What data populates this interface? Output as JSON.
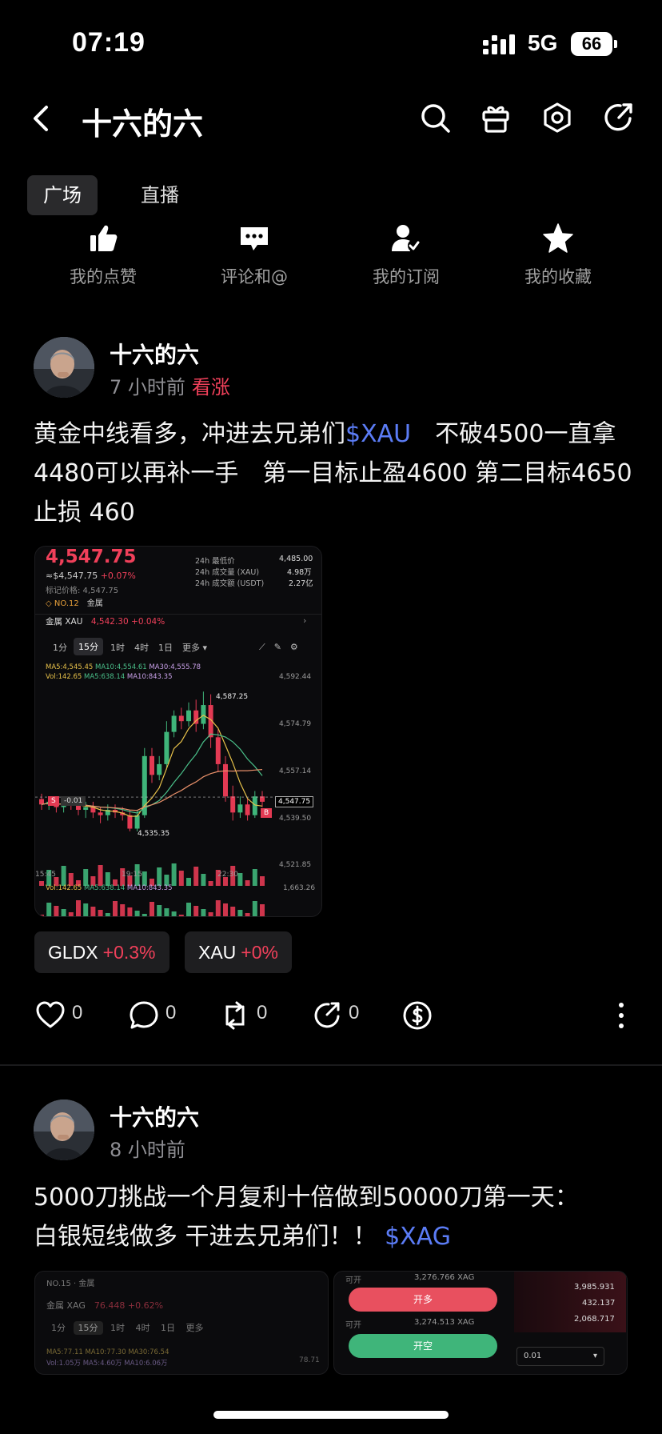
{
  "status_bar": {
    "time": "07:19",
    "network": "5G",
    "battery": "66"
  },
  "header": {
    "title": "十六的六"
  },
  "tabs": [
    {
      "label": "广场"
    },
    {
      "label": "直播"
    }
  ],
  "quick_links": [
    {
      "label": "我的点赞",
      "icon": "thumbs-up-icon"
    },
    {
      "label": "评论和@",
      "icon": "comment-icon"
    },
    {
      "label": "我的订阅",
      "icon": "subscribe-icon"
    },
    {
      "label": "我的收藏",
      "icon": "star-icon"
    }
  ],
  "posts": [
    {
      "author": "十六的六",
      "time": "7 小时前",
      "sentiment": "看涨",
      "text_before": "黄金中线看多，冲进去兄弟们",
      "cashtag": "$XAU",
      "text_after": "　不破4500一直拿 4480可以再补一手　第一目标止盈4600 第二目标4650　止损 460",
      "chart": {
        "price": "4,547.75",
        "sub_price": "≈$4,547.75",
        "sub_change": "+0.07%",
        "mark_price": "标记价格: 4,547.75",
        "rank": "NO.12",
        "rank_tag": "金属",
        "stats": [
          {
            "label": "24h 最低价",
            "value": "4,485.00"
          },
          {
            "label": "24h 成交量 (XAU)",
            "value": "4.98万"
          },
          {
            "label": "24h 成交额 (USDT)",
            "value": "2.27亿"
          }
        ],
        "pair_label": "金属  XAU",
        "pair_price": "4,542.30",
        "pair_change": "+0.04%",
        "intervals": [
          "1分",
          "15分",
          "1时",
          "4时",
          "1日",
          "更多"
        ],
        "active_interval": "15分",
        "ma_line": "MA5:4,545.45",
        "ma10": "MA10:4,554.61",
        "ma30": "MA30:4,555.78",
        "vol_line": "Vol:142.65",
        "vol_ma5": "MA5:638.14",
        "vol_ma10": "MA10:843.35",
        "y_ticks": [
          "4,592.44",
          "4,574.79",
          "4,557.14",
          "4,539.50",
          "4,521.85"
        ],
        "x_ticks": [
          "15:45",
          "19:15",
          "22:30"
        ],
        "high_label": "4,587.25",
        "low_label": "4,535.35",
        "last_label": "4,547.75",
        "vol_max": "1,663.26",
        "marker_s": "S",
        "marker_b": "B",
        "marker_val": "-0.01"
      },
      "chips": [
        {
          "symbol": "GLDX",
          "change": "+0.3%"
        },
        {
          "symbol": "XAU",
          "change": "+0%"
        }
      ],
      "actions": {
        "likes": "0",
        "comments": "0",
        "reposts": "0",
        "shares": "0"
      }
    },
    {
      "author": "十六的六",
      "time": "8 小时前",
      "text_line1": "5000刀挑战一个月复利十倍做到50000刀第一天：",
      "text_line2_before": "白银短线做多 干进去兄弟们！！ ",
      "cashtag": "$XAG",
      "thumb1": {
        "rank": "NO.15 · 金属",
        "pair": "金属 XAG",
        "price": "76.448 +0.62%",
        "intervals": [
          "1分",
          "15分",
          "1时",
          "4时",
          "1日",
          "更多"
        ],
        "ma_line": "MA5:77.11  MA10:77.30  MA30:76.54",
        "vol_line": "Vol:1.05万  MA5:4.60万  MA10:6.06万",
        "tick": "78.71"
      },
      "thumb2": {
        "avail1": "可开",
        "avail1_val": "3,276.766 XAG",
        "buy": "开多",
        "avail2": "可开",
        "avail2_val": "3,274.513 XAG",
        "sell": "开空",
        "qty": "0.01",
        "book": [
          "3,985.931",
          "432.137",
          "2,068.717"
        ]
      }
    }
  ]
}
